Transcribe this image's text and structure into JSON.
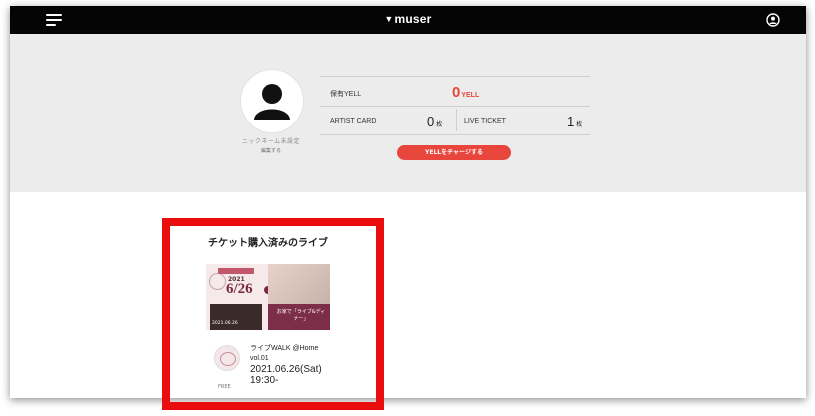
{
  "header": {
    "logo_text": "muser",
    "logo_mark": "▼",
    "menu_icon": "hamburger-menu-icon",
    "account_icon": "account-circle-icon"
  },
  "profile": {
    "nickname": "ニックネーム未設定",
    "edit_label": "編集する",
    "yell_label": "保有YELL",
    "yell_value": "0",
    "yell_unit": "YELL",
    "artist_card_label": "ARTIST CARD",
    "artist_card_value": "0",
    "artist_card_unit": "枚",
    "live_ticket_label": "LIVE TICKET",
    "live_ticket_value": "1",
    "live_ticket_unit": "枚",
    "charge_button": "YELLをチャージする"
  },
  "purchased_section": {
    "title": "チケット購入済みのライブ",
    "events": [
      {
        "banner_year": "2021",
        "banner_date": "6/26",
        "banner_headline": "お家で「ライブ&ディナー」",
        "banner_footer": "2021.06.26",
        "name": "ライブWALK @Home vol.01",
        "datetime": "2021.06.26(Sat) 19:30-",
        "price": "FREE"
      }
    ]
  },
  "colors": {
    "accent": "#e8453c",
    "header_bg": "#050505",
    "highlight": "#ea0d0d",
    "band_bg": "#ececec"
  }
}
